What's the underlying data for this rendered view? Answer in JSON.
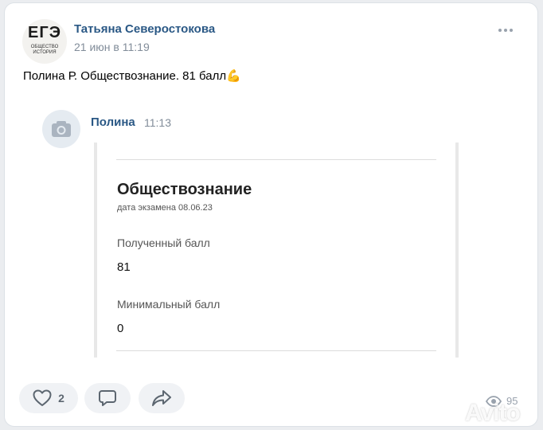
{
  "post": {
    "author": "Татьяна Северостокова",
    "date": "21 июн в 11:19",
    "text": "Полина Р. Обществознание. 81 балл",
    "emoji": "💪"
  },
  "avatar": {
    "big_text": "ЕГЭ",
    "sub_line1": "ОБЩЕСТВО",
    "sub_line2": "ИСТОРИЯ"
  },
  "reply": {
    "name": "Полина",
    "time": "11:13"
  },
  "screenshot": {
    "subject": "Обществознание",
    "exam_date": "дата экзамена 08.06.23",
    "received_label": "Полученный балл",
    "received_value": "81",
    "min_label": "Минимальный балл",
    "min_value": "0"
  },
  "actions": {
    "likes": "2",
    "views": "95"
  },
  "watermark": "Avito",
  "colors": {
    "link": "#2a5885",
    "muted": "#818c99",
    "button_bg": "#f0f2f5"
  }
}
